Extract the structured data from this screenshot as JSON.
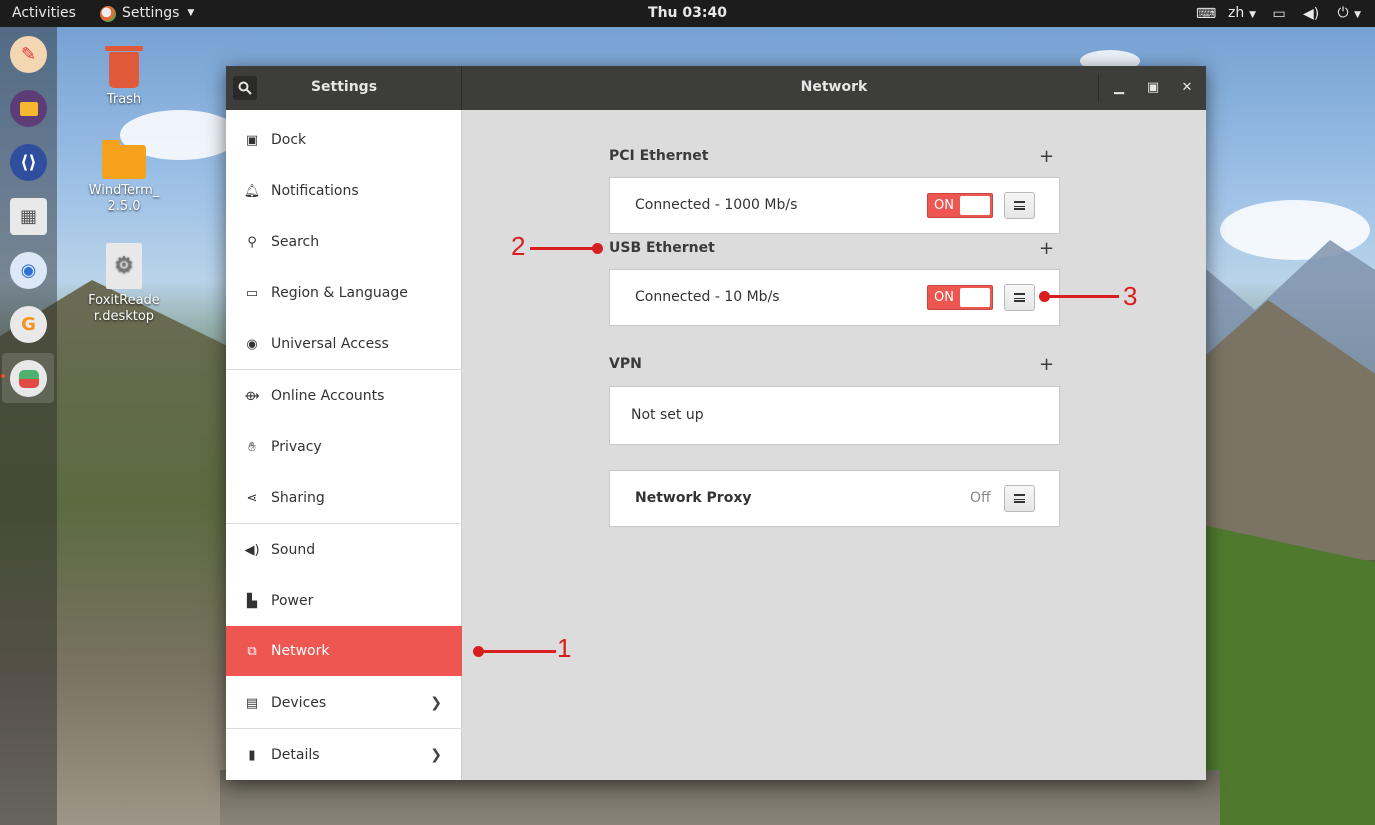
{
  "topbar": {
    "activities": "Activities",
    "app_name": "Settings",
    "clock": "Thu 03:40",
    "lang": "zh",
    "icons": [
      "keyboard-icon",
      "display-icon",
      "volume-icon",
      "power-icon"
    ]
  },
  "dock": {
    "apps": [
      "drawing-app-icon",
      "files-icon",
      "vscode-icon",
      "calculator-icon",
      "chrome-icon",
      "foxit-icon",
      "settings-toggle-icon"
    ]
  },
  "desktop": {
    "icons": [
      {
        "label": "Trash"
      },
      {
        "label": "WindTerm_ 2.5.0"
      },
      {
        "label": "FoxitReade r.desktop"
      }
    ]
  },
  "window": {
    "sidebar_title": "Settings",
    "title": "Network"
  },
  "sidebar": {
    "items": [
      {
        "label": "Dock",
        "icon": "dock-icon"
      },
      {
        "label": "Notifications",
        "icon": "bell-icon"
      },
      {
        "label": "Search",
        "icon": "search-icon"
      },
      {
        "label": "Region & Language",
        "icon": "flag-icon"
      },
      {
        "label": "Universal Access",
        "icon": "accessibility-icon"
      },
      {
        "label": "Online Accounts",
        "icon": "accounts-icon"
      },
      {
        "label": "Privacy",
        "icon": "hand-icon"
      },
      {
        "label": "Sharing",
        "icon": "share-icon"
      },
      {
        "label": "Sound",
        "icon": "speaker-icon"
      },
      {
        "label": "Power",
        "icon": "power-plug-icon"
      },
      {
        "label": "Network",
        "icon": "network-icon",
        "active": true
      },
      {
        "label": "Devices",
        "icon": "devices-icon"
      },
      {
        "label": "Details",
        "icon": "info-icon"
      }
    ]
  },
  "network": {
    "pci": {
      "title": "PCI Ethernet",
      "status": "Connected - 1000 Mb/s",
      "switch": "ON"
    },
    "usb": {
      "title": "USB Ethernet",
      "status": "Connected - 10 Mb/s",
      "switch": "ON"
    },
    "vpn": {
      "title": "VPN",
      "status": "Not set up"
    },
    "proxy": {
      "title": "Network Proxy",
      "state": "Off"
    }
  },
  "annotations": {
    "one": "1",
    "two": "2",
    "three": "3"
  },
  "colors": {
    "accent": "#ee5651",
    "annotation": "#d81e1e",
    "headerbar": "#3d3d3b"
  }
}
